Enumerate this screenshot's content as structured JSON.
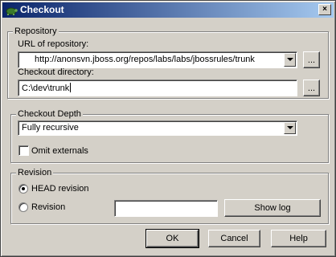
{
  "window": {
    "title": "Checkout",
    "close_glyph": "×",
    "icon": "turtle-icon"
  },
  "repository": {
    "group_title": "Repository",
    "url_label": "URL of repository:",
    "url_value": "http://anonsvn.jboss.org/repos/labs/labs/jbossrules/trunk",
    "url_browse_label": "...",
    "dir_label": "Checkout directory:",
    "dir_value": "C:\\dev\\trunk",
    "dir_browse_label": "..."
  },
  "depth": {
    "group_title": "Checkout Depth",
    "selected": "Fully recursive",
    "omit_externals_label": "Omit externals",
    "omit_externals_checked": false
  },
  "revision": {
    "group_title": "Revision",
    "head_label": "HEAD revision",
    "head_selected": true,
    "revision_label": "Revision",
    "revision_value": "",
    "show_log_label": "Show log"
  },
  "buttons": {
    "ok": "OK",
    "cancel": "Cancel",
    "help": "Help"
  }
}
